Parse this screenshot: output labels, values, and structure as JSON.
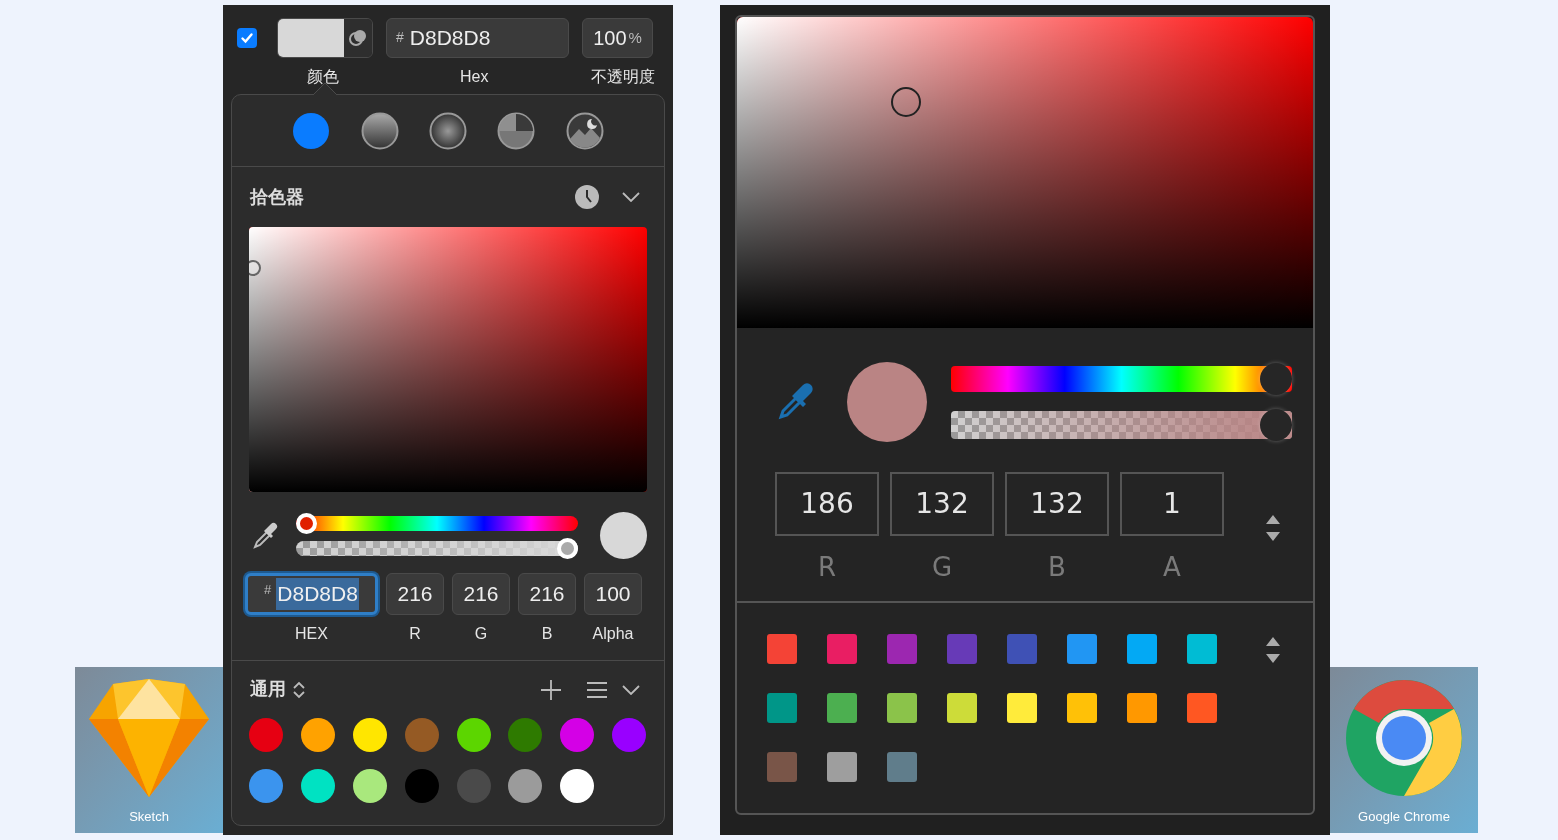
{
  "sketch": {
    "fill_enabled": true,
    "header": {
      "hex_prefix": "#",
      "hex": "D8D8D8",
      "opacity": "100",
      "opacity_unit": "%",
      "labels": [
        "颜色",
        "Hex",
        "不透明度"
      ]
    },
    "fill_types": [
      {
        "kind": "solid",
        "selected": true
      },
      {
        "kind": "linear",
        "selected": false
      },
      {
        "kind": "radial",
        "selected": false
      },
      {
        "kind": "angular",
        "selected": false
      },
      {
        "kind": "image",
        "selected": false
      }
    ],
    "picker_title": "拾色器",
    "hue": {
      "level": 0
    },
    "alpha": {
      "level": 1
    },
    "fields": [
      {
        "kind": "hex",
        "prefix": "#",
        "value": "D8D8D8",
        "label": "HEX",
        "focused": true
      },
      {
        "kind": "number",
        "value": "216",
        "label": "R",
        "focused": false
      },
      {
        "kind": "number",
        "value": "216",
        "label": "G",
        "focused": false
      },
      {
        "kind": "number",
        "value": "216",
        "label": "B",
        "focused": false
      },
      {
        "kind": "number",
        "value": "100",
        "label": "Alpha",
        "focused": false
      }
    ],
    "presets_title": "通用",
    "swatches": [
      {
        "color": "#e60012"
      },
      {
        "color": "#ffa200"
      },
      {
        "color": "#ffe600"
      },
      {
        "color": "#955a24"
      },
      {
        "color": "#5cd600"
      },
      {
        "color": "#2e7a00"
      },
      {
        "color": "#d400e6"
      },
      {
        "color": "#9900ff"
      },
      {
        "color": "#3b94ee"
      },
      {
        "color": "#00e2c2"
      },
      {
        "color": "#a9e87d"
      },
      {
        "color": "#000000"
      },
      {
        "color": "#4a4a4a"
      },
      {
        "color": "#9b9b9b"
      },
      {
        "color": "#ffffff"
      }
    ]
  },
  "chrome": {
    "hue": {
      "level": 1
    },
    "alpha": {
      "level": 1
    },
    "fields": [
      {
        "value": "186",
        "label": "R"
      },
      {
        "value": "132",
        "label": "G"
      },
      {
        "value": "132",
        "label": "B"
      },
      {
        "value": "1",
        "label": "A"
      }
    ],
    "swatches": [
      {
        "color": "#f44336"
      },
      {
        "color": "#e91e63"
      },
      {
        "color": "#9c27b0"
      },
      {
        "color": "#673ab7"
      },
      {
        "color": "#3f51b5"
      },
      {
        "color": "#2196f3"
      },
      {
        "color": "#03a9f4"
      },
      {
        "color": "#00bcd4"
      },
      {
        "color": "#009688"
      },
      {
        "color": "#4caf50"
      },
      {
        "color": "#8bc34a"
      },
      {
        "color": "#cddc39"
      },
      {
        "color": "#ffeb3b"
      },
      {
        "color": "#ffc107"
      },
      {
        "color": "#ff9800"
      },
      {
        "color": "#ff5722"
      },
      {
        "color": "#795548"
      },
      {
        "color": "#9e9e9e"
      },
      {
        "color": "#607d8b"
      }
    ]
  },
  "apps": [
    {
      "kind": "sketch",
      "label": "Sketch"
    },
    {
      "kind": "chrome",
      "label": "Google Chrome"
    }
  ]
}
